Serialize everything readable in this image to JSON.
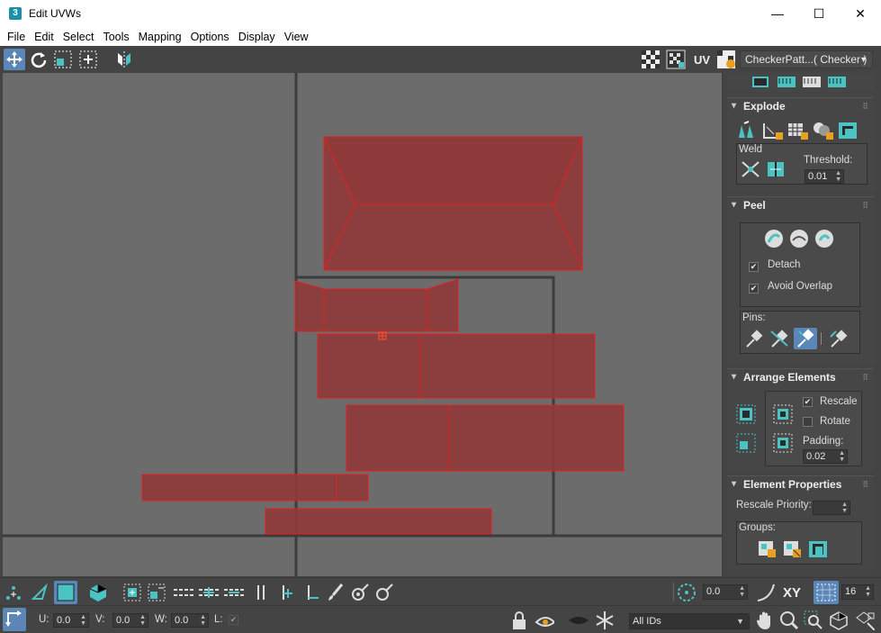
{
  "window": {
    "title": "Edit UVWs",
    "app_icon": "3",
    "minimize": "—",
    "maximize": "☐",
    "close": "✕"
  },
  "menu": [
    "File",
    "Edit",
    "Select",
    "Tools",
    "Mapping",
    "Options",
    "Display",
    "View"
  ],
  "toolbar": {
    "uv_label": "UV",
    "texture_dropdown": "CheckerPatt...( Checker )"
  },
  "panel": {
    "explode": {
      "title": "Explode",
      "weld_label": "Weld",
      "threshold_label": "Threshold:",
      "threshold_value": "0.01"
    },
    "peel": {
      "title": "Peel",
      "detach_label": "Detach",
      "detach_checked": true,
      "avoid_overlap_label": "Avoid Overlap",
      "avoid_overlap_checked": true,
      "pins_label": "Pins:"
    },
    "arrange": {
      "title": "Arrange Elements",
      "rescale_label": "Rescale",
      "rescale_checked": true,
      "rotate_label": "Rotate",
      "rotate_checked": false,
      "padding_label": "Padding:",
      "padding_value": "0.02"
    },
    "element_props": {
      "title": "Element Properties",
      "rescale_priority_label": "Rescale Priority:",
      "rescale_priority_value": "",
      "groups_label": "Groups:"
    }
  },
  "bottom": {
    "soft_value": "0.0",
    "xy_label": "XY",
    "zoom_value": "16",
    "u_label": "U:",
    "u_value": "0.0",
    "v_label": "V:",
    "v_value": "0.0",
    "w_label": "W:",
    "w_value": "0.0",
    "l_label": "L:",
    "ids_dropdown": "All IDs"
  },
  "colors": {
    "uv_face": "#8e3a3a",
    "uv_edge": "#e02020",
    "viewport_bg": "#6c6c6c",
    "accent": "#4cc3c3"
  }
}
